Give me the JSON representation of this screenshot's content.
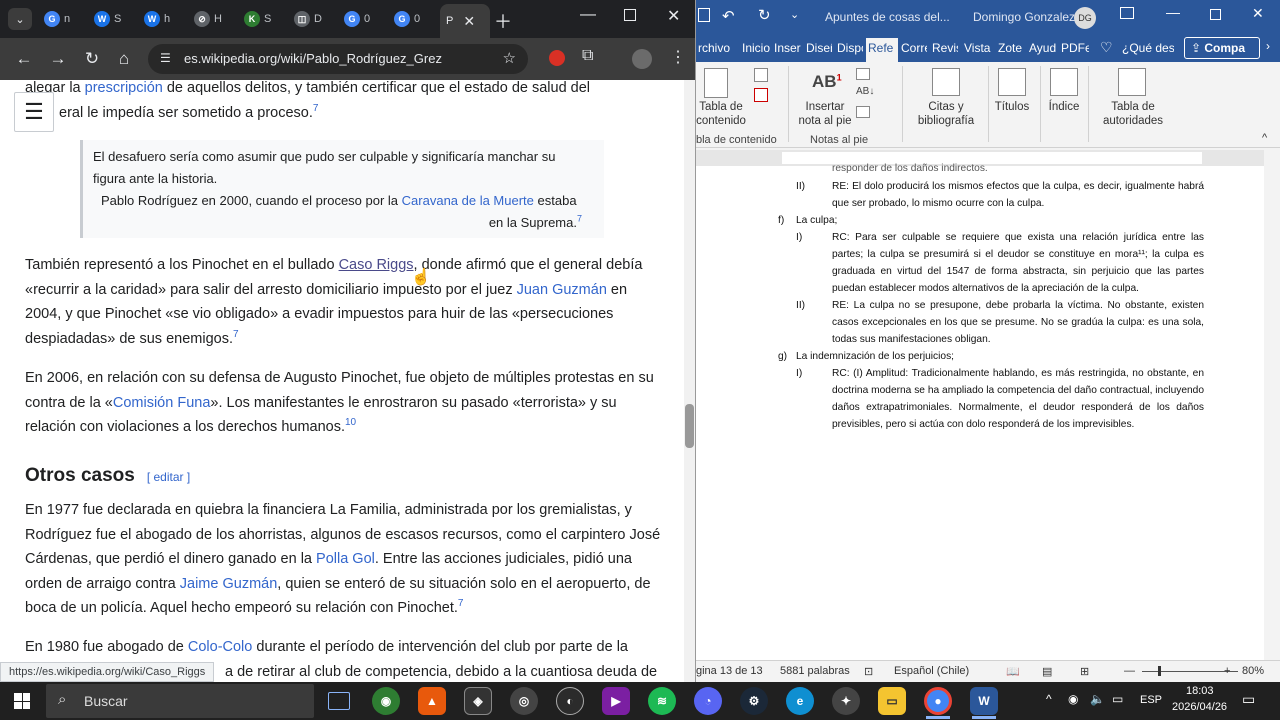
{
  "chrome": {
    "tabs": [
      {
        "fav": "G",
        "title": "n",
        "color": "#4285f4"
      },
      {
        "fav": "W",
        "title": "S",
        "color": "#1a73e8"
      },
      {
        "fav": "W",
        "title": "h",
        "color": "#1a73e8"
      },
      {
        "fav": "⊘",
        "title": "H",
        "color": "#5f6368"
      },
      {
        "fav": "K",
        "title": "S",
        "color": "#2e7d32"
      },
      {
        "fav": "◫",
        "title": "D",
        "color": "#5f6368"
      },
      {
        "fav": "G",
        "title": "0",
        "color": "#4285f4"
      },
      {
        "fav": "G",
        "title": "0",
        "color": "#4285f4"
      }
    ],
    "active_tab": {
      "title": "P"
    },
    "url": "es.wikipedia.org/wiki/Pablo_Rodríguez_Grez",
    "status_url": "https://es.wikipedia.org/wiki/Caso_Riggs"
  },
  "wiki": {
    "p0_a": "alegar la ",
    "p0_link": "prescripción",
    "p0_b": " de aquellos delitos, y también certificar que el estado de salud del",
    "p0_c": "eral le impedía ser sometido a proceso.",
    "p0_ref": "7",
    "quote_text_1": "El desafuero sería como asumir que pudo ser culpable y significaría manchar su",
    "quote_text_2": "figura ante la historia.",
    "quote_attr_a": "Pablo Rodríguez en 2000, cuando el proceso por la ",
    "quote_attr_link": "Caravana de la Muerte",
    "quote_attr_b": " estaba",
    "quote_attr_c": "en la Suprema.",
    "quote_ref": "7",
    "p1_a": "También representó a los Pinochet en el bullado ",
    "p1_link1": "Caso Riggs",
    "p1_b": ", donde afirmó que el general debía «recurrir a la caridad» para salir del arresto domiciliario impuesto por el juez ",
    "p1_link2": "Juan Guzmán",
    "p1_c": " en 2004, y que Pinochet «se vio obligado» a evadir impuestos para huir de las «persecuciones despiadadas» de sus enemigos.",
    "p1_ref": "7",
    "p2_a": "En 2006, en relación con su defensa de Augusto Pinochet, fue objeto de múltiples protestas en su contra de la «",
    "p2_link": "Comisión Funa",
    "p2_b": "». Los manifestantes le enrostraron su pasado «terrorista» y su relación con violaciones a los derechos humanos.",
    "p2_ref": "10",
    "h2": "Otros casos",
    "h2_edit": "[ editar ]",
    "p3_a": "En 1977 fue declarada en quiebra la financiera La Familia, administrada por los gremialistas, y Rodríguez fue el abogado de los ahorristas, algunos de escasos recursos, como el carpintero José Cárdenas, que perdió el dinero ganado en la ",
    "p3_link1": "Polla Gol",
    "p3_b": ". Entre las acciones judiciales, pidió una orden de arraigo contra ",
    "p3_link2": "Jaime Guzmán",
    "p3_c": ", quien se enteró de su situación solo en el aeropuerto, de boca de un policía. Aquel hecho empeoró su relación con Pinochet.",
    "p3_ref": "7",
    "p4_a": "En 1980 fue abogado de ",
    "p4_link": "Colo-Colo",
    "p4_b": " durante el período de intervención del club por parte de la",
    "p4_c": "a de retirar al club de competencia, debido a la cuantiosa deuda de"
  },
  "word": {
    "title": "Apuntes de cosas del...",
    "user": "Domingo Gonzalez",
    "user_initials": "DG",
    "tabs": [
      "rchivo",
      "Inicio",
      "Inser",
      "Diseñ",
      "Dispo",
      "Refe",
      "Corre",
      "Revis",
      "Vista",
      "Zote",
      "Ayud",
      "PDFe",
      "¿Qué des"
    ],
    "share": "Compa",
    "ribbon": {
      "tabla_contenido": "Tabla de contenido",
      "tabla_contenido_group": "bla de contenido",
      "insertar_nota": "Insertar nota al pie",
      "notas_group": "Notas al pie",
      "citas": "Citas y bibliografía",
      "titulos": "Títulos",
      "indice": "Índice",
      "tabla_autoridades": "Tabla de autoridades"
    },
    "doc": {
      "top_cut": "responder de los daños indirectos.",
      "eII_num": "II)",
      "eII_text": "RE: El dolo producirá los mismos efectos que la culpa, es decir, igualmente habrá que ser probado, lo mismo ocurre con la culpa.",
      "f_label": "f)",
      "f_text": "La culpa;",
      "fI_num": "I)",
      "fI_text": "RC: Para ser culpable se requiere que exista una relación jurídica entre las partes; la culpa se presumirá si el deudor se constituye en mora¹¹; la culpa es graduada en virtud del 1547 de forma abstracta, sin perjuicio que las partes puedan establecer modos alternativos de la apreciación de la culpa.",
      "fII_num": "II)",
      "fII_text": "RE: La culpa no se presupone, debe probarla la víctima. No obstante, existen casos excepcionales en los que se presume. No se gradúa la culpa: es una sola, todas sus manifestaciones obligan.",
      "g_label": "g)",
      "g_text": "La indemnización de los perjuicios;",
      "gI_num": "I)",
      "gI_text": "RC: (I) Amplitud: Tradicionalmente hablando, es más restringida, no obstante, en doctrina moderna se ha ampliado la competencia del daño contractual, incluyendo daños extrapatrimoniales. Normalmente, el deudor responderá de los daños previsibles, pero si actúa con dolo responderá de los imprevisibles."
    },
    "status": {
      "page": "gina 13 de 13",
      "words": "5881 palabras",
      "lang": "Español (Chile)",
      "zoom": "80%"
    }
  },
  "taskbar": {
    "search": "Buscar",
    "lang": "ESP",
    "time": "18:03",
    "date": "2026/04/26"
  }
}
